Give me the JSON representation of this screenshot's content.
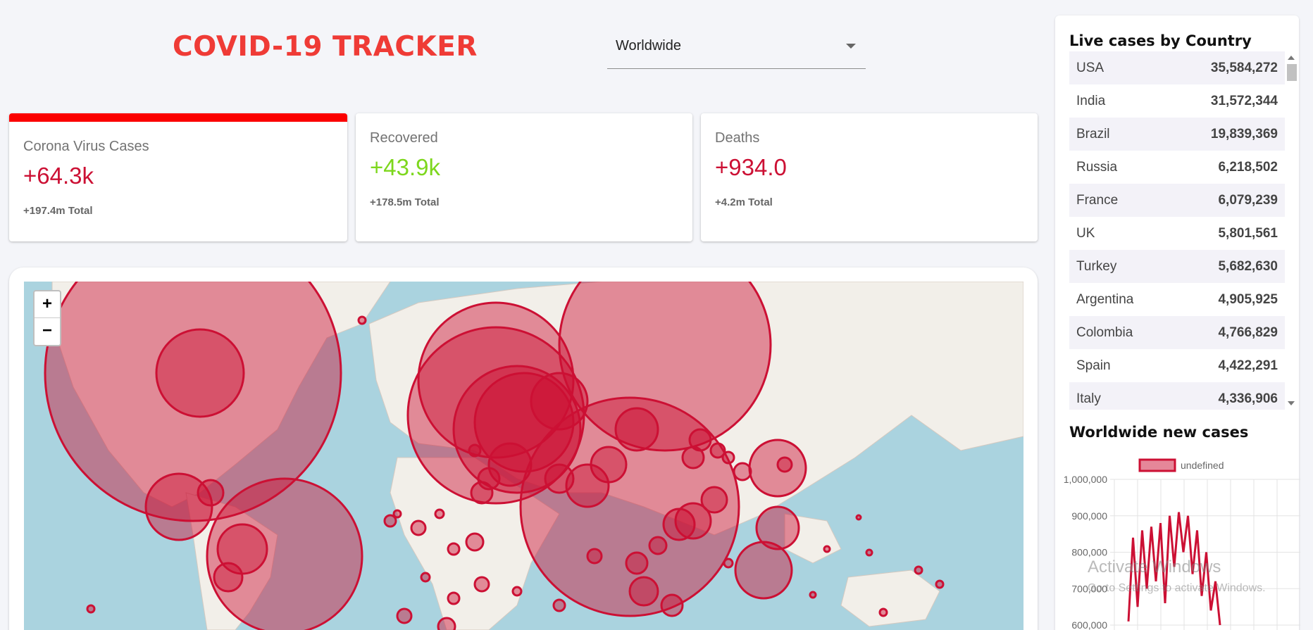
{
  "header": {
    "title": "COVID-19 TRACKER"
  },
  "country_select": {
    "selected": "Worldwide"
  },
  "stats": [
    {
      "label": "Corona Virus Cases",
      "today": "+64.3k",
      "total": "+197.4m Total",
      "color": "#cc1034",
      "active": true
    },
    {
      "label": "Recovered",
      "today": "+43.9k",
      "total": "+178.5m Total",
      "color": "#7dd71d",
      "active": false
    },
    {
      "label": "Deaths",
      "today": "+934.0",
      "total": "+4.2m Total",
      "color": "#cc1034",
      "active": false
    }
  ],
  "map": {
    "zoom_in": "+",
    "zoom_out": "−",
    "circle_color": "#cc1034"
  },
  "live_cases": {
    "title": "Live cases by Country",
    "rows": [
      {
        "country": "USA",
        "cases": "35,584,272"
      },
      {
        "country": "India",
        "cases": "31,572,344"
      },
      {
        "country": "Brazil",
        "cases": "19,839,369"
      },
      {
        "country": "Russia",
        "cases": "6,218,502"
      },
      {
        "country": "France",
        "cases": "6,079,239"
      },
      {
        "country": "UK",
        "cases": "5,801,561"
      },
      {
        "country": "Turkey",
        "cases": "5,682,630"
      },
      {
        "country": "Argentina",
        "cases": "4,905,925"
      },
      {
        "country": "Colombia",
        "cases": "4,766,829"
      },
      {
        "country": "Spain",
        "cases": "4,422,291"
      },
      {
        "country": "Italy",
        "cases": "4,336,906"
      }
    ]
  },
  "chart_data": {
    "type": "line",
    "title": "Worldwide new cases",
    "legend": "undefined",
    "y_ticks": [
      "1,000,000",
      "900,000",
      "800,000",
      "700,000",
      "600,000"
    ],
    "ylim": [
      600000,
      1000000
    ],
    "values": [
      610000,
      840000,
      650000,
      860000,
      700000,
      870000,
      720000,
      880000,
      660000,
      900000,
      760000,
      910000,
      800000,
      900000,
      740000,
      860000,
      680000,
      800000,
      640000,
      720000,
      600000
    ]
  },
  "watermark": {
    "line1": "Activate Windows",
    "line2": "Go to Settings to activate Windows."
  }
}
